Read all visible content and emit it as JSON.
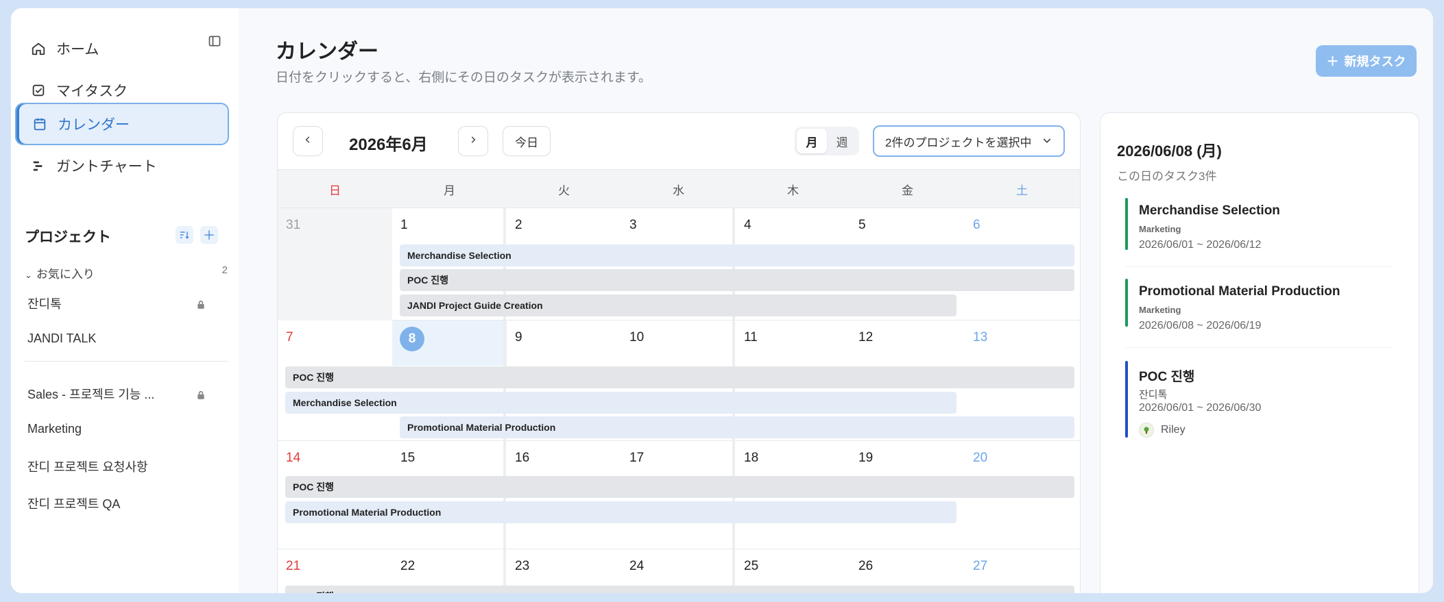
{
  "sidebar": {
    "nav": [
      {
        "label": "ホーム",
        "icon": "home-icon"
      },
      {
        "label": "マイタスク",
        "icon": "checkbox-icon"
      },
      {
        "label": "カレンダー",
        "icon": "calendar-icon"
      },
      {
        "label": "ガントチャート",
        "icon": "gantt-icon"
      }
    ],
    "projects_header": "プロジェクト",
    "favorites_label": "お気に入り",
    "favorites_count": "2",
    "favorite_projects": [
      {
        "name": "잔디톡",
        "locked": true
      },
      {
        "name": "JANDI TALK",
        "locked": false
      }
    ],
    "projects": [
      {
        "name": "Sales - 프로젝트 기능 ...",
        "locked": true
      },
      {
        "name": "Marketing",
        "locked": false
      },
      {
        "name": "잔디 프로젝트 요청사항",
        "locked": false
      },
      {
        "name": "잔디 프로젝트 QA",
        "locked": false
      }
    ]
  },
  "header": {
    "title": "カレンダー",
    "subtitle": "日付をクリックすると、右側にその日のタスクが表示されます。",
    "new_task_label": "新規タスク"
  },
  "calendar": {
    "month_label": "2026年6月",
    "today_label": "今日",
    "view_month": "月",
    "view_week": "週",
    "project_select": "2件のプロジェクトを選択中",
    "weekdays": [
      "日",
      "月",
      "火",
      "水",
      "木",
      "金",
      "土"
    ],
    "weeks": [
      {
        "days": [
          "31",
          "1",
          "2",
          "3",
          "4",
          "5",
          "6"
        ],
        "bars": [
          {
            "label": "Merchandise Selection"
          },
          {
            "label": "POC 진행"
          },
          {
            "label": "JANDI Project Guide Creation"
          }
        ]
      },
      {
        "days": [
          "7",
          "8",
          "9",
          "10",
          "11",
          "12",
          "13"
        ],
        "bars": [
          {
            "label": "POC 진행"
          },
          {
            "label": "Merchandise Selection"
          },
          {
            "label": "Promotional Material Production"
          }
        ]
      },
      {
        "days": [
          "14",
          "15",
          "16",
          "17",
          "18",
          "19",
          "20"
        ],
        "bars": [
          {
            "label": "POC 진행"
          },
          {
            "label": "Promotional Material Production"
          }
        ]
      },
      {
        "days": [
          "21",
          "22",
          "23",
          "24",
          "25",
          "26",
          "27"
        ],
        "bars": [
          {
            "label": "POC 진행"
          }
        ]
      }
    ]
  },
  "detail": {
    "date": "2026/06/08 (月)",
    "count": "この日のタスク3件",
    "tasks": [
      {
        "title": "Merchandise Selection",
        "project": "Marketing",
        "range": "2026/06/01 ~ 2026/06/12",
        "color": "#1a9a5a"
      },
      {
        "title": "Promotional Material Production",
        "project": "Marketing",
        "range": "2026/06/08 ~ 2026/06/19",
        "color": "#1a9a5a"
      },
      {
        "title": "POC 진행",
        "project": "잔디톡",
        "range": "2026/06/01 ~ 2026/06/30",
        "color": "#1f4fc4",
        "assignee": "Riley"
      }
    ]
  },
  "colors": {
    "accent": "#3a80d6",
    "sunday": "#e23b3b",
    "saturday": "#6aa5e6",
    "selected_day": "#7fb2ea"
  }
}
